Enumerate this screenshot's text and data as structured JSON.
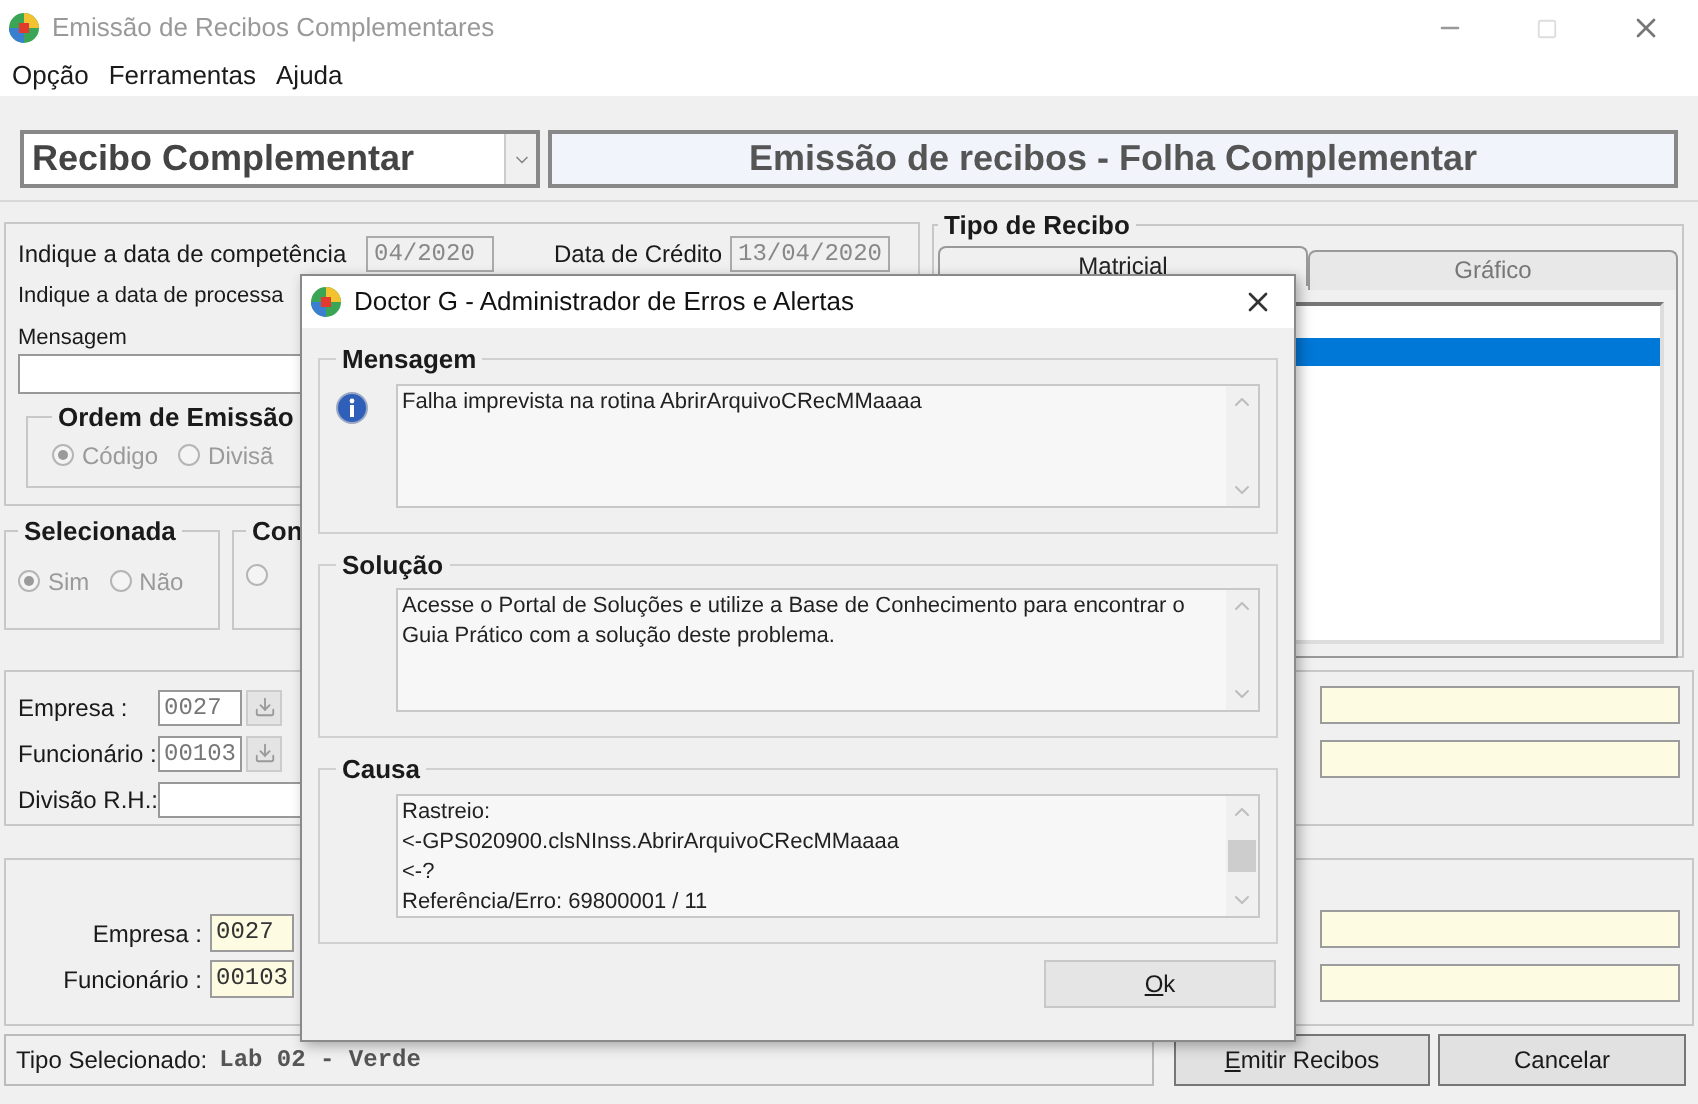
{
  "window": {
    "title": "Emissão de Recibos Complementares"
  },
  "menu": [
    "Opção",
    "Ferramentas",
    "Ajuda"
  ],
  "receipt_type_combo": {
    "value": "Recibo Complementar"
  },
  "header_title": "Emissão de recibos - Folha Complementar",
  "dates": {
    "competencia_label": "Indique a data de competência",
    "competencia_value": "04/2020",
    "credito_label": "Data de Crédito",
    "credito_value": "13/04/2020",
    "processamento_label": "Indique a data de processa"
  },
  "mensagem_label": "Mensagem",
  "ordem_emissao": {
    "title": "Ordem de Emissão",
    "options": [
      {
        "label": "Código",
        "selected": true
      },
      {
        "label": "Divisã",
        "selected": false
      }
    ]
  },
  "selecionada": {
    "title": "Selecionada",
    "options": [
      {
        "label": "Sim",
        "selected": true
      },
      {
        "label": "Não",
        "selected": false
      }
    ]
  },
  "group_3": {
    "title": "Con",
    "options": [
      {
        "selected": false
      }
    ]
  },
  "tipo_recibo": {
    "title": "Tipo de Recibo",
    "tabs": [
      {
        "label": "Matricial",
        "selected": true
      },
      {
        "label": "Gráfico",
        "selected": false
      }
    ],
    "rows": [
      {
        "selected": false
      },
      {
        "selected": true
      }
    ]
  },
  "filters": [
    {
      "label": "Empresa :",
      "value": "0027",
      "kind": "lookup"
    },
    {
      "label": "Funcionário :",
      "value": "00103",
      "kind": "lookup"
    },
    {
      "label": "Divisão R.H.:",
      "kind": "text"
    }
  ],
  "selection": [
    {
      "label": "Empresa :",
      "value": "0027"
    },
    {
      "label": "Funcionário :",
      "value": "00103"
    }
  ],
  "status": {
    "label": "Tipo Selecionado:",
    "value": "Lab 02 - Verde"
  },
  "buttons": [
    "Emitir Recibos",
    "Cancelar"
  ],
  "dialog": {
    "title": "Doctor G - Administrador de Erros e Alertas",
    "sections": [
      {
        "title": "Mensagem",
        "kind": "info",
        "lines": [
          "Falha imprevista na rotina AbrirArquivoCRecMMaaaa"
        ]
      },
      {
        "title": "Solução",
        "kind": "plain",
        "lines": [
          "Acesse o Portal de Soluções e utilize a Base de Conhecimento para encontrar o Guia Prático com a solução deste problema."
        ]
      },
      {
        "title": "Causa",
        "kind": "plain",
        "scrolled": true,
        "lines": [
          "Rastreio:",
          "<-GPS020900.clsNInss.AbrirArquivoCRecMMaaaa",
          "<-?",
          "Referência/Erro: 69800001 / 11"
        ]
      }
    ],
    "ok": "Ok"
  }
}
